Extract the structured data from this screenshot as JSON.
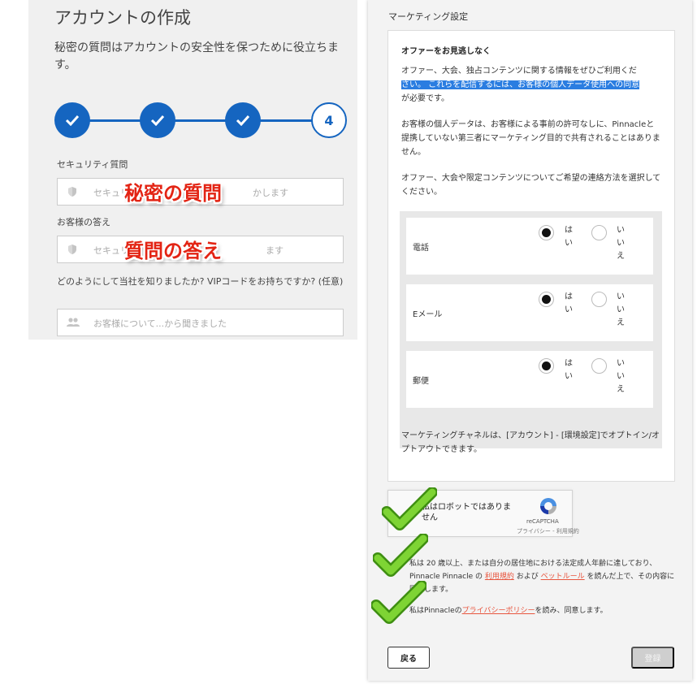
{
  "left": {
    "title": "アカウントの作成",
    "subtitle": "秘密の質問はアカウントの安全性を保つために役立ちます。",
    "steps": [
      {
        "state": "done"
      },
      {
        "state": "done"
      },
      {
        "state": "done"
      },
      {
        "state": "current",
        "label": "4"
      }
    ],
    "security_question_label": "セキュリティ質問",
    "security_question_placeholder_left": "セキュリ",
    "security_question_placeholder_right": "かします",
    "answer_label": "お客様の答え",
    "answer_placeholder_left": "セキュリ",
    "answer_placeholder_right": "ます",
    "referral_label": "どのようにして当社を知りましたか? VIPコードをお持ちですか? (任意)",
    "referral_placeholder": "お客様について...から聞きました",
    "overlay_question": "秘密の質問",
    "overlay_answer": "質問の答え"
  },
  "right": {
    "section_title": "マーケティング設定",
    "card": {
      "heading": "オファーをお見逃しなく",
      "para1_a": "オファー、大会、独占コンテンツに関する情報をぜひご利用くだ",
      "para1_highlight": "さい。 これらを配信するには、お客様の個人データ使用への同意",
      "para1_b": "が必要です。",
      "para2": "お客様の個人データは、お客様による事前の許可なしに、Pinnacleと提携していない第三者にマーケティング目的で共有されることはありません。",
      "para3": "オファー、大会や限定コンテンツについてご希望の連絡方法を選択してください。",
      "channels": [
        {
          "label": "電話",
          "yes": "はい",
          "no": "いいえ",
          "selected": "yes"
        },
        {
          "label": "Eメール",
          "yes": "はい",
          "no": "いいえ",
          "selected": "yes"
        },
        {
          "label": "郵便",
          "yes": "はい",
          "no": "いいえ",
          "selected": "yes"
        }
      ],
      "note": "マーケティングチャネルは、[アカウント] - [環境設定]でオプトイン/オプトアウトできます。"
    },
    "captcha": {
      "text": "私はロボットではありません",
      "brand": "reCAPTCHA",
      "links": "プライバシー - 利用規約"
    },
    "agree1_a": "私は 20 歳以上、または自分の居住地における法定成人年齢に達しており、Pinnacle Pinnacle の ",
    "agree1_link1": "利用規約",
    "agree1_b": " および ",
    "agree1_link2": "ベットルール",
    "agree1_c": " を読んだ上で、その内容に同意します。",
    "agree2_a": "私はPinnacleの",
    "agree2_link": "プライバシーポリシー",
    "agree2_b": "を読み、同意します。",
    "back_button": "戻る",
    "register_button": "登録"
  },
  "colors": {
    "accent_blue": "#1565c0",
    "overlay_red": "#e32414",
    "check_green": "#6cc424",
    "link_orange": "#e8553e"
  }
}
